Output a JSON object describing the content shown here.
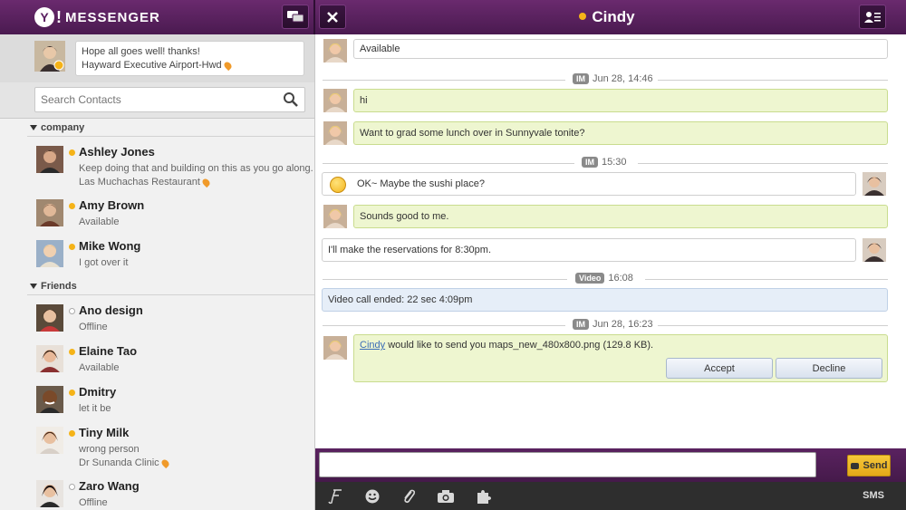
{
  "app": {
    "brand": "MESSENGER",
    "logo_letter": "Y",
    "logo_mark": "!"
  },
  "header": {
    "contact_name": "Cindy",
    "contact_status_color": "#f5b318"
  },
  "me": {
    "status_line1": "Hope all goes well! thanks!",
    "status_line2": "Hayward Executive Airport-Hwd"
  },
  "search": {
    "placeholder": "Search Contacts"
  },
  "groups": [
    {
      "name": "company",
      "contacts": [
        {
          "name": "Ashley Jones",
          "status": "online",
          "line1": "Keep doing that and building on this as you go along.",
          "line2": "Las Muchachas Restaurant"
        },
        {
          "name": "Amy Brown",
          "status": "online",
          "line1": "Available"
        },
        {
          "name": "Mike Wong",
          "status": "online",
          "line1": "I got over it"
        }
      ]
    },
    {
      "name": "Friends",
      "contacts": [
        {
          "name": "Ano design",
          "status": "offline",
          "line1": "Offline"
        },
        {
          "name": "Elaine Tao",
          "status": "online",
          "line1": "Available"
        },
        {
          "name": "Dmitry",
          "status": "online",
          "line1": "let it be"
        },
        {
          "name": "Tiny Milk",
          "status": "online",
          "line1": "wrong person",
          "line2": "Dr Sunanda Clinic"
        },
        {
          "name": "Zaro Wang",
          "status": "offline",
          "line1": "Offline"
        }
      ]
    }
  ],
  "chat": {
    "status_msg": "Available",
    "separators": [
      {
        "tag": "IM",
        "time": "Jun 28, 14:46"
      },
      {
        "tag": "IM",
        "time": "15:30"
      },
      {
        "tag": "Video",
        "time": "16:08"
      },
      {
        "tag": "IM",
        "time": "Jun 28, 16:23"
      }
    ],
    "messages": [
      {
        "from": "Cindy",
        "text": "hi"
      },
      {
        "from": "Cindy",
        "text": "Want to grad some lunch over in Sunnyvale tonite?"
      },
      {
        "from": "me",
        "text": "OK~ Maybe the sushi place?"
      },
      {
        "from": "Cindy",
        "text": "Sounds good to me."
      },
      {
        "from": "me",
        "text": "I'll make the reservations for 8:30pm."
      }
    ],
    "video_call": "Video call ended: 22 sec 4:09pm",
    "file_request": {
      "sender": "Cindy",
      "text": "would like to send you maps_new_480x800.png (129.8 KB).",
      "accept": "Accept",
      "decline": "Decline"
    }
  },
  "composer": {
    "send": "Send",
    "sms": "SMS",
    "input_value": ""
  },
  "toolbar_icons": [
    "font-icon",
    "emoticon-icon",
    "attachment-icon",
    "camera-icon",
    "plugin-icon"
  ],
  "colors": {
    "header_purple": "#5a1f60",
    "incoming_bubble": "#eef6d0",
    "system_bubble": "#e6eef8",
    "online": "#f5b318",
    "send_button": "#f0b823"
  }
}
